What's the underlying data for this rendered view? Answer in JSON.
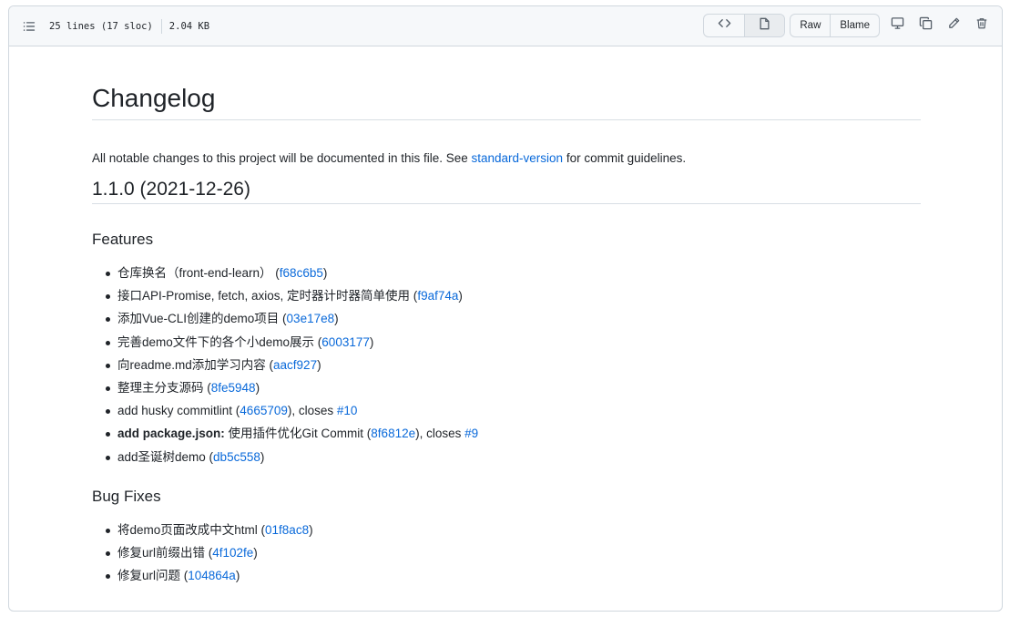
{
  "header": {
    "lines_info": "25 lines (17 sloc)",
    "size_info": "2.04 KB",
    "raw_label": "Raw",
    "blame_label": "Blame"
  },
  "icons": {
    "outline": "list-unordered-icon",
    "code_view": "code-icon",
    "preview": "file-icon",
    "display": "desktop-icon",
    "copy": "copy-icon",
    "edit": "pencil-icon",
    "delete": "trash-icon"
  },
  "markdown": {
    "title": "Changelog",
    "intro": {
      "before": "All notable changes to this project will be documented in this file. See ",
      "link": "standard-version",
      "after": " for commit guidelines."
    },
    "version_heading": "1.1.0 (2021-12-26)",
    "features_heading": "Features",
    "features": [
      {
        "bold": "",
        "text": "仓库换名（front-end-learn） (",
        "hash": "f68c6b5",
        "closes": "",
        "issue": ""
      },
      {
        "bold": "",
        "text": "接口API-Promise, fetch, axios, 定时器计时器简单使用 (",
        "hash": "f9af74a",
        "closes": "",
        "issue": ""
      },
      {
        "bold": "",
        "text": "添加Vue-CLI创建的demo项目 (",
        "hash": "03e17e8",
        "closes": "",
        "issue": ""
      },
      {
        "bold": "",
        "text": "完善demo文件下的各个小demo展示 (",
        "hash": "6003177",
        "closes": "",
        "issue": ""
      },
      {
        "bold": "",
        "text": "向readme.md添加学习内容 (",
        "hash": "aacf927",
        "closes": "",
        "issue": ""
      },
      {
        "bold": "",
        "text": "整理主分支源码 (",
        "hash": "8fe5948",
        "closes": "",
        "issue": ""
      },
      {
        "bold": "",
        "text": "add husky commitlint (",
        "hash": "4665709",
        "closes": "), closes ",
        "issue": "#10"
      },
      {
        "bold": "add package.json:",
        "text": " 使用插件优化Git Commit (",
        "hash": "8f6812e",
        "closes": "), closes ",
        "issue": "#9"
      },
      {
        "bold": "",
        "text": "add圣诞树demo (",
        "hash": "db5c558",
        "closes": "",
        "issue": ""
      }
    ],
    "bugfix_heading": "Bug Fixes",
    "bugfixes": [
      {
        "text": "将demo页面改成中文html (",
        "hash": "01f8ac8"
      },
      {
        "text": "修复url前缀出错 (",
        "hash": "4f102fe"
      },
      {
        "text": "修复url问题 (",
        "hash": "104864a"
      }
    ]
  },
  "colors": {
    "link": "#0969da",
    "text": "#1f2328",
    "border": "#d0d7de",
    "header_bg": "#f6f8fa"
  }
}
